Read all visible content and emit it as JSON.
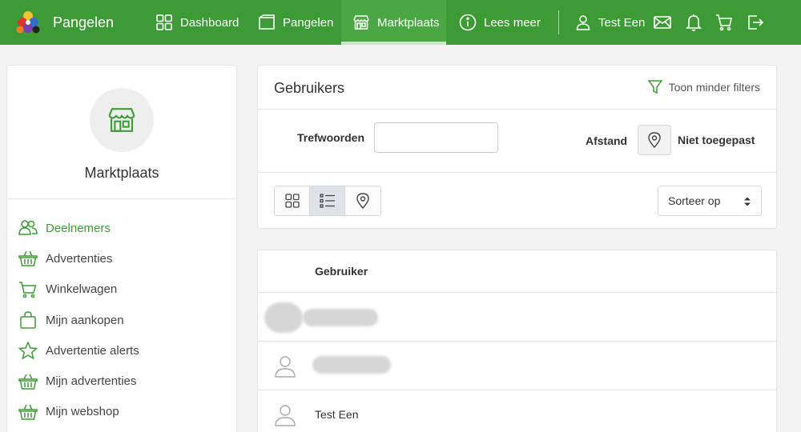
{
  "header": {
    "brand": "Pangelen",
    "nav": [
      {
        "label": "Dashboard",
        "icon": "dashboard-grid-icon"
      },
      {
        "label": "Pangelen",
        "icon": "folder-icon"
      },
      {
        "label": "Marktplaats",
        "icon": "store-icon",
        "active": true
      },
      {
        "label": "Lees meer",
        "icon": "info-icon"
      }
    ],
    "user_name": "Test Een",
    "icons": [
      "user-icon",
      "mail-icon",
      "bell-icon",
      "cart-icon",
      "logout-icon"
    ]
  },
  "sidebar": {
    "title": "Marktplaats",
    "items": [
      {
        "label": "Deelnemers",
        "icon": "users-icon",
        "active": true
      },
      {
        "label": "Advertenties",
        "icon": "basket-icon"
      },
      {
        "label": "Winkelwagen",
        "icon": "cart-icon"
      },
      {
        "label": "Mijn aankopen",
        "icon": "shopping-bag-icon"
      },
      {
        "label": "Advertentie alerts",
        "icon": "star-icon"
      },
      {
        "label": "Mijn advertenties",
        "icon": "basket-icon"
      },
      {
        "label": "Mijn webshop",
        "icon": "basket-icon"
      }
    ]
  },
  "filters": {
    "title": "Gebruikers",
    "toggle_label": "Toon minder filters",
    "keywords_label": "Trefwoorden",
    "keywords_value": "",
    "distance_label": "Afstand",
    "distance_value": "Niet toegepast",
    "sort_label": "Sorteer op",
    "views": [
      "grid-view-icon",
      "list-view-icon",
      "map-view-icon"
    ],
    "active_view": "list"
  },
  "users": {
    "column_header": "Gebruiker",
    "rows": [
      {
        "name": "",
        "redacted": true,
        "redacted_avatar": true
      },
      {
        "name": "",
        "redacted": true,
        "redacted_avatar": false
      },
      {
        "name": "Test Een",
        "redacted": false,
        "redacted_avatar": false
      }
    ]
  },
  "colors": {
    "brand_green": "#3d9b35",
    "active_nav": "#4aa842"
  }
}
